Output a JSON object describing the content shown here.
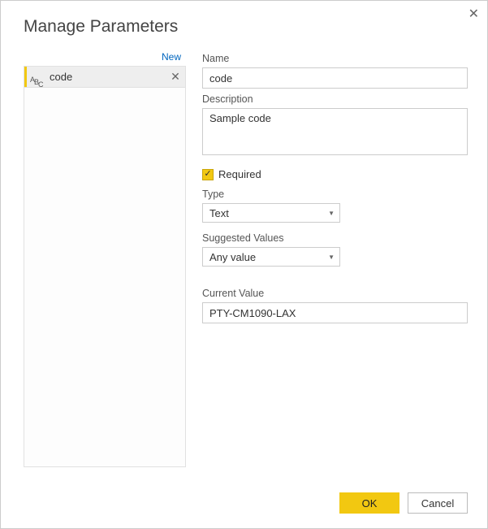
{
  "dialog": {
    "title": "Manage Parameters",
    "new_link": "New"
  },
  "param_list": {
    "items": [
      {
        "label": "code"
      }
    ]
  },
  "form": {
    "name_label": "Name",
    "name_value": "code",
    "description_label": "Description",
    "description_value": "Sample code",
    "required_label": "Required",
    "type_label": "Type",
    "type_value": "Text",
    "suggested_label": "Suggested Values",
    "suggested_value": "Any value",
    "current_label": "Current Value",
    "current_value": "PTY-CM1090-LAX"
  },
  "footer": {
    "ok": "OK",
    "cancel": "Cancel"
  }
}
